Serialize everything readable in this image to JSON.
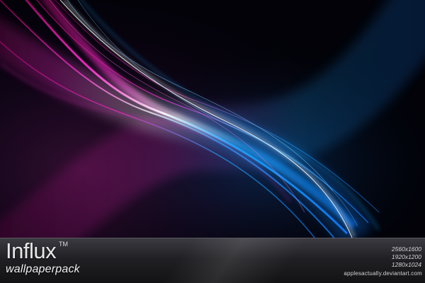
{
  "brand": {
    "title": "Influx",
    "trademark": "TM",
    "subtitle": "wallpaperpack"
  },
  "resolutions": [
    "2560x1600",
    "1920x1200",
    "1280x1024"
  ],
  "credit": "applesactually.deviantart.com",
  "colors": {
    "background": "#020208",
    "magenta": "#ff2dcf",
    "blue": "#1aa8ff",
    "white_core": "#ffffff",
    "bar_top": "#3a3a40",
    "bar_bottom": "#121214",
    "text": "#e7e7ea"
  }
}
